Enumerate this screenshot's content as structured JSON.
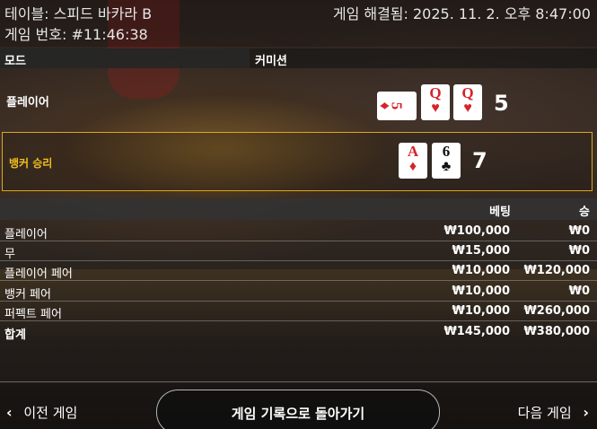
{
  "header": {
    "table_title": "테이블: 스피드 바카라 B",
    "resolved": "게임 해결됨: 2025. 11. 2. 오후 8:47:00",
    "game_number": "게임 번호: #11:46:38"
  },
  "mode_bar": {
    "mode_label": "모드",
    "commission_label": "커미션"
  },
  "player": {
    "label": "플레이어",
    "cards": [
      {
        "rank": "5",
        "suit": "♦",
        "color": "#d6232a",
        "orientation": "sideways"
      },
      {
        "rank": "Q",
        "suit": "♥",
        "color": "#d6232a"
      },
      {
        "rank": "Q",
        "suit": "♥",
        "color": "#d6232a"
      }
    ],
    "score": "5"
  },
  "banker": {
    "label": "뱅커 승리",
    "highlight_color": "#d9a81e",
    "cards": [
      {
        "rank": "A",
        "suit": "♦",
        "color": "#d6232a"
      },
      {
        "rank": "6",
        "suit": "♣",
        "color": "#111111"
      }
    ],
    "score": "7"
  },
  "bets_table": {
    "headers": {
      "bet": "베팅",
      "win": "승"
    },
    "rows": [
      {
        "name": "플레이어",
        "bet": "₩100,000",
        "win": "₩0"
      },
      {
        "name": "무",
        "bet": "₩15,000",
        "win": "₩0"
      },
      {
        "name": "플레이어 페어",
        "bet": "₩10,000",
        "win": "₩120,000"
      },
      {
        "name": "뱅커 페어",
        "bet": "₩10,000",
        "win": "₩0"
      },
      {
        "name": "퍼펙트 페어",
        "bet": "₩10,000",
        "win": "₩260,000"
      }
    ],
    "total": {
      "name": "합계",
      "bet": "₩145,000",
      "win": "₩380,000"
    }
  },
  "footer": {
    "prev_label": "이전 게임",
    "back_label": "게임 기록으로 돌아가기",
    "next_label": "다음 게임",
    "prev_icon": "‹",
    "next_icon": "›"
  }
}
